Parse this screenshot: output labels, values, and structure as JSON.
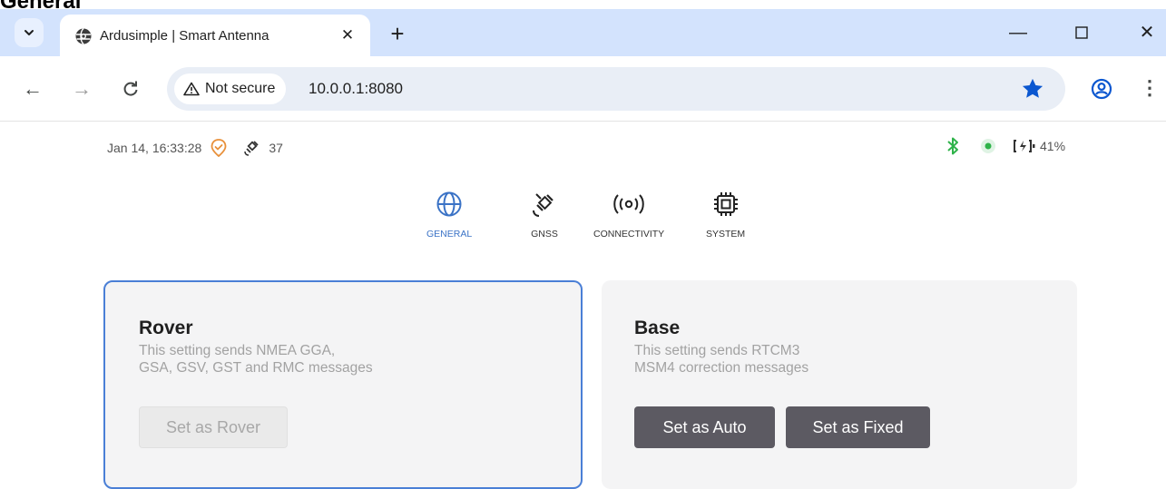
{
  "page_heading": "General",
  "browser": {
    "tab_title": "Ardusimple | Smart Antenna",
    "security_label": "Not secure",
    "url": "10.0.0.1:8080"
  },
  "status": {
    "datetime": "Jan 14, 16:33:28",
    "satellites": "37",
    "battery": "41%"
  },
  "nav": {
    "tabs": [
      {
        "label": "GENERAL",
        "icon": "globe-icon",
        "active": true
      },
      {
        "label": "GNSS",
        "icon": "satellite-icon",
        "active": false
      },
      {
        "label": "CONNECTIVITY",
        "icon": "broadcast-icon",
        "active": false
      },
      {
        "label": "SYSTEM",
        "icon": "chip-icon",
        "active": false
      }
    ]
  },
  "cards": {
    "rover": {
      "title": "Rover",
      "desc_line1": "This setting sends NMEA GGA,",
      "desc_line2": "GSA, GSV, GST and RMC messages",
      "button": "Set as Rover"
    },
    "base": {
      "title": "Base",
      "desc_line1": "This setting sends RTCM3",
      "desc_line2": "MSM4 correction messages",
      "button_auto": "Set as Auto",
      "button_fixed": "Set as Fixed"
    }
  },
  "colors": {
    "accent": "#3b73c6",
    "tabstrip": "#d3e3fd",
    "bluetooth": "#2fb34a",
    "gps_fix": "#2fb34a",
    "location_badge": "#e8903a",
    "dark_button": "#5c5a62"
  }
}
